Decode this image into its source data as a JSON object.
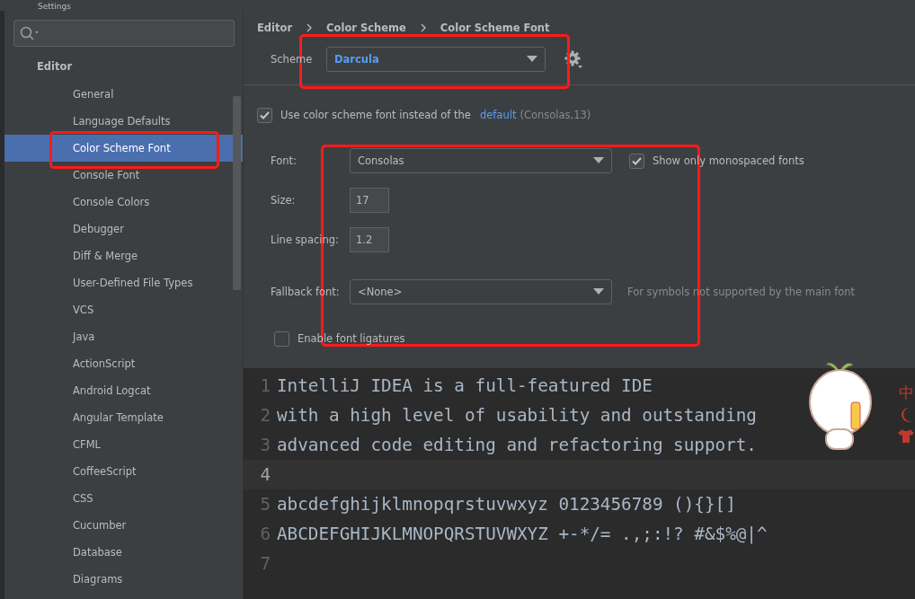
{
  "window": {
    "title": "Settings"
  },
  "sidebar": {
    "section": "Editor",
    "items": [
      {
        "label": "General",
        "selected": false
      },
      {
        "label": "Language Defaults",
        "selected": false
      },
      {
        "label": "Color Scheme Font",
        "selected": true
      },
      {
        "label": "Console Font",
        "selected": false
      },
      {
        "label": "Console Colors",
        "selected": false
      },
      {
        "label": "Debugger",
        "selected": false
      },
      {
        "label": "Diff & Merge",
        "selected": false
      },
      {
        "label": "User-Defined File Types",
        "selected": false
      },
      {
        "label": "VCS",
        "selected": false
      },
      {
        "label": "Java",
        "selected": false
      },
      {
        "label": "ActionScript",
        "selected": false
      },
      {
        "label": "Android Logcat",
        "selected": false
      },
      {
        "label": "Angular Template",
        "selected": false
      },
      {
        "label": "CFML",
        "selected": false
      },
      {
        "label": "CoffeeScript",
        "selected": false
      },
      {
        "label": "CSS",
        "selected": false
      },
      {
        "label": "Cucumber",
        "selected": false
      },
      {
        "label": "Database",
        "selected": false
      },
      {
        "label": "Diagrams",
        "selected": false
      }
    ]
  },
  "breadcrumb": [
    "Editor",
    "Color Scheme",
    "Color Scheme Font"
  ],
  "scheme": {
    "label": "Scheme",
    "value": "Darcula"
  },
  "use_scheme_font": {
    "checked": true,
    "label": "Use color scheme font instead of the",
    "link": "default",
    "hint": "(Consolas,13)"
  },
  "font": {
    "label": "Font:",
    "value": "Consolas"
  },
  "monospaced_only": {
    "checked": true,
    "label": "Show only monospaced fonts"
  },
  "size": {
    "label": "Size:",
    "value": "17"
  },
  "line_spacing": {
    "label": "Line spacing:",
    "value": "1.2"
  },
  "fallback": {
    "label": "Fallback font:",
    "value": "<None>",
    "hint": "For symbols not supported by the main font"
  },
  "ligatures": {
    "checked": false,
    "label": "Enable font ligatures"
  },
  "preview": {
    "lines": [
      {
        "number": "1",
        "text": "IntelliJ IDEA is a full-featured IDE",
        "current": false
      },
      {
        "number": "2",
        "text": "with a high level of usability and outstanding",
        "current": false
      },
      {
        "number": "3",
        "text": "advanced code editing and refactoring support.",
        "current": false
      },
      {
        "number": "4",
        "current": true
      },
      {
        "number": "5",
        "text": "abcdefghijklmnopqrstuvwxyz 0123456789 (){}[]",
        "current": false
      },
      {
        "number": "6",
        "text": "ABCDEFGHIJKLMNOPQRSTUVWXYZ +-*/= .,;:!? #&$%@|^",
        "current": false
      },
      {
        "number": "7",
        "current": false
      }
    ]
  },
  "ime_toolbar": {
    "mode": "中"
  }
}
